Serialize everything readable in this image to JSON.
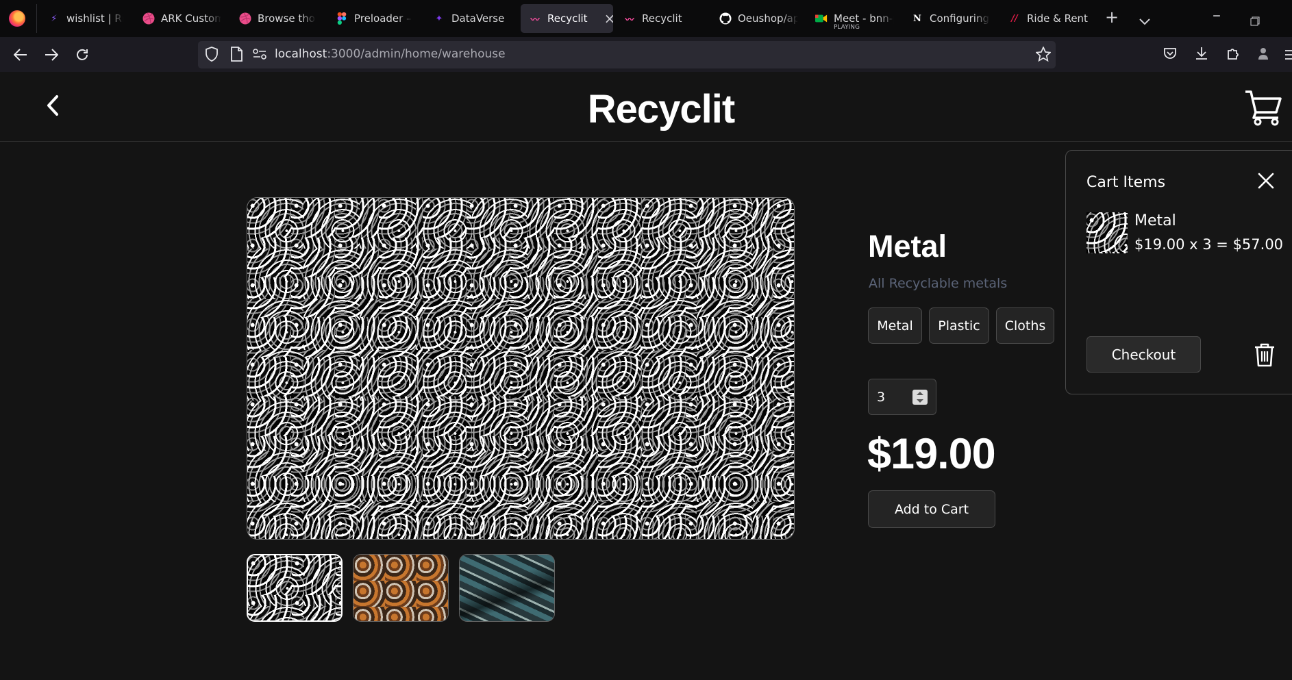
{
  "browser": {
    "tabs": [
      {
        "label": "wishlist | Ride",
        "favicon": "bolt-icon",
        "color": "#8b5cf6"
      },
      {
        "label": "ARK Custome",
        "favicon": "dribbble-icon",
        "color": "#ea4c89"
      },
      {
        "label": "Browse thous",
        "favicon": "dribbble-icon",
        "color": "#ea4c89"
      },
      {
        "label": "Preloader – F",
        "favicon": "figma-icon",
        "color": "#f24e1e"
      },
      {
        "label": "DataVerse",
        "favicon": "dataverse-icon",
        "color": "#7c3aed"
      },
      {
        "label": "Recyclit",
        "favicon": "recyclit-icon",
        "color": "#ff4fa3",
        "active": true
      },
      {
        "label": "Recyclit",
        "favicon": "recyclit-icon",
        "color": "#ff4fa3"
      },
      {
        "label": "Oeushop/ap",
        "favicon": "github-icon",
        "color": "#ffffff"
      },
      {
        "label": "Meet - bnn-p",
        "sub": "PLAYING",
        "favicon": "meet-icon",
        "color": "#00ac47"
      },
      {
        "label": "Configuring",
        "favicon": "notion-icon",
        "color": "#ffffff"
      },
      {
        "label": "Ride & Rent",
        "favicon": "slashes-icon",
        "color": "#e11d48"
      }
    ],
    "url": {
      "host": "localhost",
      "path": ":3000/admin/home/warehouse"
    }
  },
  "app": {
    "brand": "Recyclit"
  },
  "product": {
    "title": "Metal",
    "subtitle": "All Recyclable metals",
    "categories": [
      "Metal",
      "Plastic",
      "Cloths"
    ],
    "quantity": "3",
    "price": "$19.00",
    "add_to_cart": "Add to Cart"
  },
  "cart": {
    "title": "Cart Items",
    "items": [
      {
        "name": "Metal",
        "calc": "$19.00 x 3 = $57.00"
      }
    ],
    "checkout": "Checkout"
  }
}
